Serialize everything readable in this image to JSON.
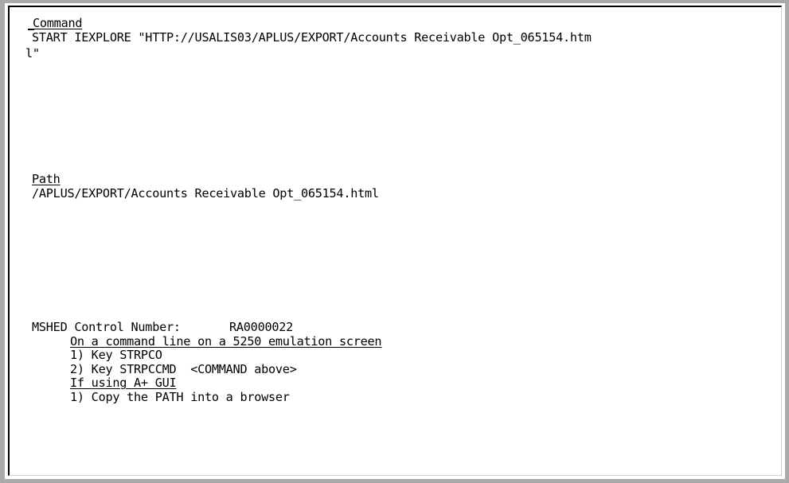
{
  "command": {
    "heading": "Command",
    "line1": "START IEXPLORE \"HTTP://USALIS03/APLUS/EXPORT/Accounts Receivable Opt_065154.htm",
    "line2": "l\""
  },
  "path": {
    "heading": "Path",
    "value": "/APLUS/EXPORT/Accounts Receivable Opt_065154.html"
  },
  "control": {
    "label": "MSHED Control Number:",
    "number": "RA0000022"
  },
  "instructions": {
    "emulation_heading": "On a command line on a 5250 emulation screen",
    "step1": "1) Key STRPCO",
    "step2": "2) Key STRPCCMD  <COMMAND above>",
    "gui_heading": "If using A+ GUI",
    "gui_step1": "1) Copy the PATH into a browser"
  }
}
